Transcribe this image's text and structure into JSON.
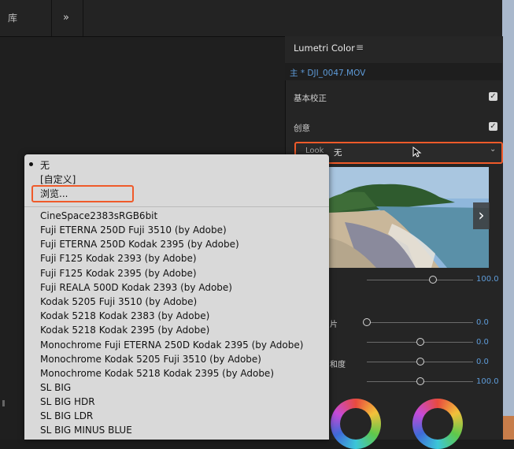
{
  "topbar": {
    "library_tab": "库",
    "more_tabs": "»"
  },
  "panel": {
    "title": "Lumetri Color",
    "clip": "主 * DJI_0047.MOV",
    "basic_correction": "基本校正",
    "creative": "创意",
    "look_label": "Look",
    "look_value": "无",
    "sliders": [
      {
        "label": "",
        "value": "100.0",
        "level": 0.62
      },
      {
        "label": "片",
        "value": "0.0",
        "level": 0.0
      },
      {
        "label": "",
        "value": "0.0",
        "level": 0.5
      },
      {
        "label": "和度",
        "value": "0.0",
        "level": 0.5
      },
      {
        "label": "",
        "value": "100.0",
        "level": 0.5
      }
    ]
  },
  "dropdown": {
    "items": [
      "无",
      "[自定义]",
      "浏览...",
      "CineSpace2383sRGB6bit",
      "Fuji ETERNA 250D Fuji 3510 (by Adobe)",
      "Fuji ETERNA 250D Kodak 2395 (by Adobe)",
      "Fuji F125 Kodak 2393 (by Adobe)",
      "Fuji F125 Kodak 2395 (by Adobe)",
      "Fuji REALA 500D Kodak 2393 (by Adobe)",
      "Kodak 5205 Fuji 3510 (by Adobe)",
      "Kodak 5218 Kodak 2383 (by Adobe)",
      "Kodak 5218 Kodak 2395 (by Adobe)",
      "Monochrome Fuji ETERNA 250D Kodak 2395 (by Adobe)",
      "Monochrome Kodak 5205 Fuji 3510 (by Adobe)",
      "Monochrome Kodak 5218 Kodak 2395 (by Adobe)",
      "SL BIG",
      "SL BIG HDR",
      "SL BIG LDR",
      "SL BIG MINUS BLUE"
    ],
    "selected_index": 0
  },
  "icons": {
    "menu": "hamburger-icon",
    "chevron": "chevron-down-icon",
    "next": "chevron-right-icon",
    "cursor": "mouse-cursor-icon"
  },
  "colors": {
    "accent_blue": "#5e9bd8",
    "highlight_orange": "#ef5a2a"
  }
}
